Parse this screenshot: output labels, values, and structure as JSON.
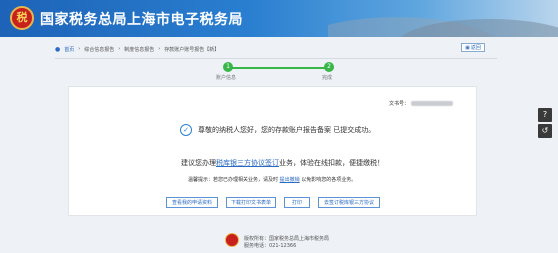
{
  "header": {
    "logo_text": "税",
    "title": "国家税务总局上海市电子税务局"
  },
  "breadcrumb": {
    "items": [
      "首页",
      "综合信息报告",
      "制度信息报告",
      "存款账户账号报告【新】"
    ]
  },
  "back_button": {
    "label": "返回"
  },
  "steps": [
    {
      "number": "1",
      "label": "账户信息"
    },
    {
      "number": "2",
      "label": "完成"
    }
  ],
  "doc_number_label": "文书号：",
  "success_message": "尊敬的纳税人您好，您的存款账户报告备案 已提交成功。",
  "recommend": {
    "prefix": "建议您办理",
    "link": "税库银三方协议签订",
    "suffix": "业务，体验在线扣款，便捷缴税！"
  },
  "tip": {
    "prefix": "温馨提示：若您已办理相关业务，请及时",
    "link": "提出撤销",
    "suffix": "以免影响您的各项业务。"
  },
  "buttons": [
    "查看我的申请资料",
    "下载打印文书表单",
    "打印",
    "去签订税库银三方协议"
  ],
  "side_tools": [
    "?",
    "↺"
  ],
  "footer": {
    "line1": "版权所有：国家税务总局上海市税务局",
    "line2": "服务电话：021-12366"
  }
}
